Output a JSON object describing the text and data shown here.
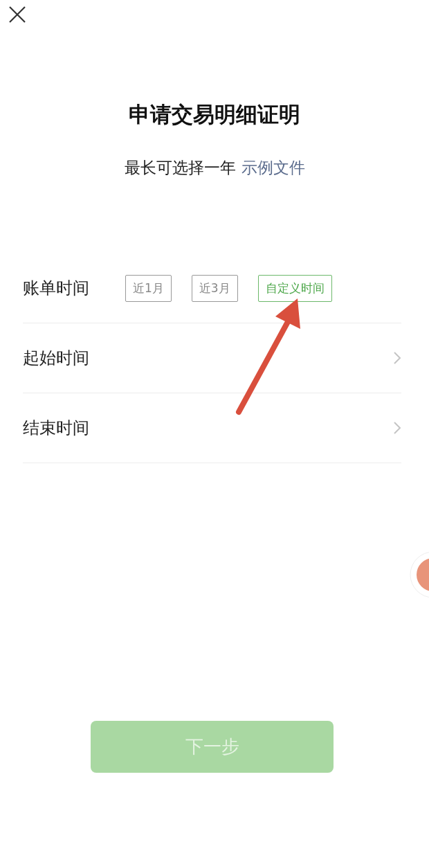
{
  "title": "申请交易明细证明",
  "subtitle": {
    "text": "最长可选择一年",
    "link": "示例文件"
  },
  "bill_time": {
    "label": "账单时间",
    "options": [
      {
        "label": "近1月",
        "selected": false
      },
      {
        "label": "近3月",
        "selected": false
      },
      {
        "label": "自定义时间",
        "selected": true
      }
    ]
  },
  "rows": [
    {
      "label": "起始时间"
    },
    {
      "label": "结束时间"
    }
  ],
  "annotation": {
    "kind": "arrow"
  },
  "next_button": {
    "label": "下一步",
    "disabled": true
  }
}
